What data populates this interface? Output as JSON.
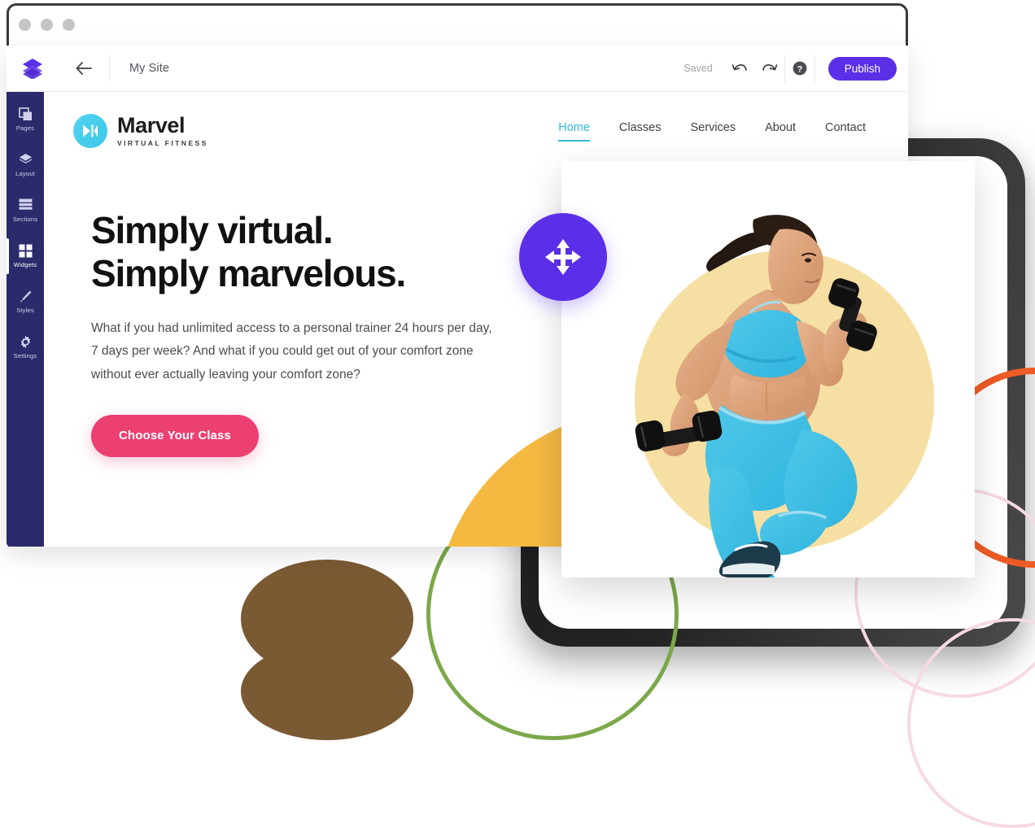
{
  "browser": {
    "dots": [
      "window-dot-1",
      "window-dot-2",
      "window-dot-3"
    ]
  },
  "builder": {
    "logo_icon": "layers-logo-icon",
    "back_icon": "back-arrow-icon",
    "site_title": "My Site",
    "saved_label": "Saved",
    "undo_icon": "undo-icon",
    "redo_icon": "redo-icon",
    "help_icon": "help-circle-icon",
    "publish_label": "Publish",
    "accent_purple": "#5b2ee8",
    "sidebar_bg": "#2b2b6b",
    "sidebar": {
      "items": [
        {
          "label": "Pages",
          "icon": "pages-icon",
          "active": false
        },
        {
          "label": "Layout",
          "icon": "layout-icon",
          "active": false
        },
        {
          "label": "Sections",
          "icon": "sections-icon",
          "active": false
        },
        {
          "label": "Widgets",
          "icon": "widgets-icon",
          "active": true
        },
        {
          "label": "Styles",
          "icon": "brush-icon",
          "active": false
        },
        {
          "label": "Settings",
          "icon": "gear-icon",
          "active": false
        }
      ]
    }
  },
  "site": {
    "brand": {
      "name": "Marvel",
      "tagline": "VIRTUAL FITNESS",
      "mark_icon": "video-play-icon",
      "mark_color": "#45cdec"
    },
    "nav": [
      {
        "label": "Home",
        "active": true
      },
      {
        "label": "Classes",
        "active": false
      },
      {
        "label": "Services",
        "active": false
      },
      {
        "label": "About",
        "active": false
      },
      {
        "label": "Contact",
        "active": false
      }
    ],
    "nav_active_color": "#35b8d8",
    "hero": {
      "heading_line_1": "Simply virtual.",
      "heading_line_2": "Simply marvelous.",
      "paragraph": "What if you had unlimited access to a personal trainer 24 hours per day, 7 days per week? And what if you could get out of your comfort zone without ever actually leaving your comfort zone?",
      "cta_label": "Choose Your Class",
      "cta_color": "#ec3f72"
    },
    "photo": {
      "alt": "woman exercising with dumbbells",
      "backdrop_color": "#f6dfa2"
    },
    "background_circle_color": "#f5b942"
  },
  "overlay": {
    "drag_handle_icon": "move-arrows-icon",
    "drag_handle_color": "#5b2ee8"
  },
  "decorations": {
    "green_circle_color": "#7ba84a",
    "orange_circle_color": "#ef5b25",
    "pink_circle_color": "#f7d9e2",
    "brown_blob_color": "#7a5a33",
    "device_frame_color": "#232323"
  }
}
